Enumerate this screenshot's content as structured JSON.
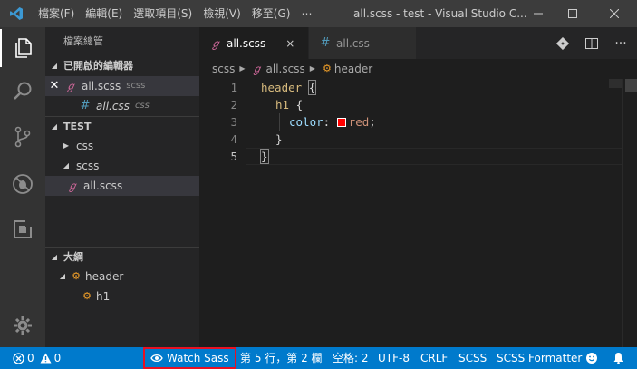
{
  "titlebar": {
    "menu": [
      "檔案(F)",
      "編輯(E)",
      "選取項目(S)",
      "檢視(V)",
      "移至(G)",
      "⋯"
    ],
    "title": "all.scss - test - Visual Studio C..."
  },
  "sidebar": {
    "title": "檔案總管",
    "open_editors_label": "已開啟的編輯器",
    "open_editors": [
      {
        "name": "all.scss",
        "desc": "scss"
      },
      {
        "name": "all.css",
        "desc": "css"
      }
    ],
    "folder_label": "TEST",
    "tree": [
      {
        "name": "css"
      },
      {
        "name": "scss"
      },
      {
        "name": "all.scss"
      }
    ],
    "outline_label": "大綱",
    "outline": [
      {
        "name": "header"
      },
      {
        "name": "h1"
      }
    ]
  },
  "tabs": [
    {
      "label": "all.scss",
      "close": "×"
    },
    {
      "label": "all.css"
    }
  ],
  "breadcrumb": [
    "scss",
    "all.scss",
    "header"
  ],
  "editor": {
    "line_numbers": [
      "1",
      "2",
      "3",
      "4",
      "5"
    ],
    "lines": {
      "l1_sel": "header",
      "l1_brace": "{",
      "l2_sel": "h1",
      "l2_brace": "{",
      "l3_prop": "color",
      "l3_colon": ":",
      "l3_val": "red",
      "l3_semi": ";",
      "l4_brace": "}",
      "l5_brace": "}"
    },
    "swatch_color": "#ff0000"
  },
  "status": {
    "errors": "0",
    "warnings": "0",
    "watch_sass": "Watch Sass",
    "position": "第 5 行，第 2 欄",
    "spaces": "空格: 2",
    "encoding": "UTF-8",
    "eol": "CRLF",
    "language": "SCSS",
    "formatter": "SCSS Formatter"
  },
  "colors": {
    "accent": "#007acc",
    "highlight_border": "#e81123"
  }
}
